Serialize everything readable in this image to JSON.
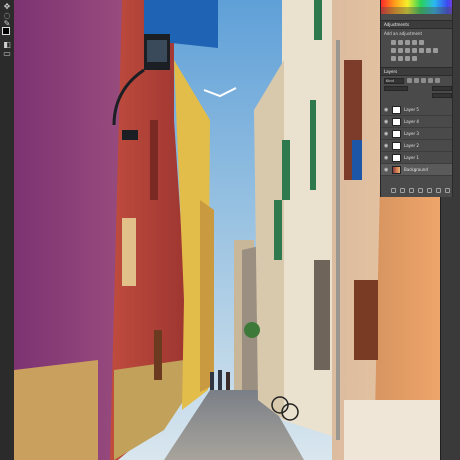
{
  "toolbar": {
    "tools": [
      "move-tool",
      "marquee-tool",
      "lasso-tool",
      "quick-select-tool",
      "crop-tool",
      "frame-tool"
    ]
  },
  "panels": {
    "adjustments": {
      "title": "Adjustments",
      "subtitle": "Add an adjustment"
    },
    "layers": {
      "title": "Layers",
      "kind_label": "Kind",
      "items": [
        {
          "name": "Layer 5",
          "visible": true
        },
        {
          "name": "Layer 4",
          "visible": true
        },
        {
          "name": "Layer 3",
          "visible": true
        },
        {
          "name": "Layer 2",
          "visible": true
        },
        {
          "name": "Layer 1",
          "visible": true
        },
        {
          "name": "Background",
          "visible": true,
          "locked": true
        }
      ]
    }
  },
  "colors": {
    "ui_dark": "#323232",
    "panel": "#4a4a4a",
    "sky": "#8fb9da",
    "magenta_wall": "#8c3a78",
    "red_wall": "#b4433a",
    "peach_wall": "#e59a5e",
    "blue_shutter": "#1f63b4"
  }
}
